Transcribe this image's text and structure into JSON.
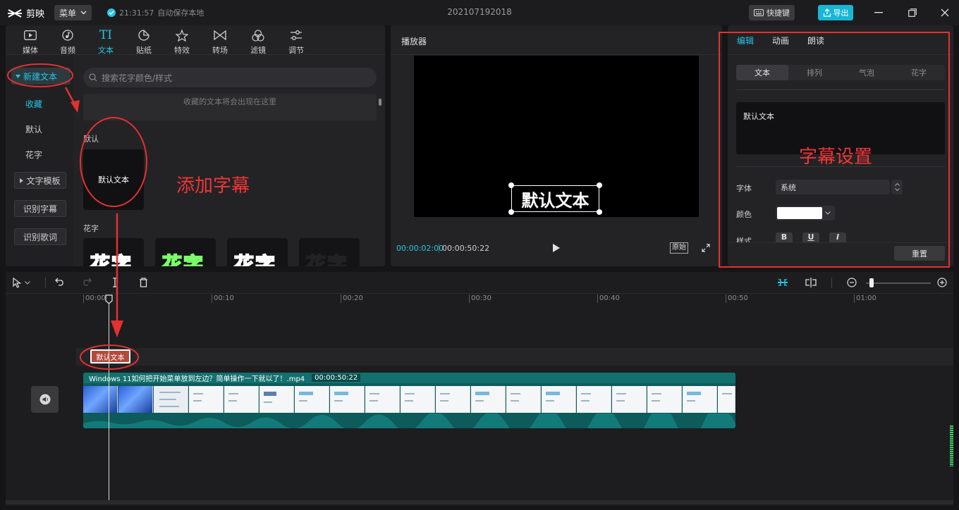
{
  "app": {
    "name": "剪映",
    "menu_label": "菜单",
    "autosave_time": "21:31:57",
    "autosave_text": "自动保存本地",
    "project_title": "202107192018",
    "shortcut_label": "快捷键",
    "export_label": "导出"
  },
  "media_tabs": [
    {
      "label": "媒体",
      "icon": "media-icon"
    },
    {
      "label": "音频",
      "icon": "audio-icon"
    },
    {
      "label": "文本",
      "icon": "text-icon",
      "active": true
    },
    {
      "label": "贴纸",
      "icon": "sticker-icon"
    },
    {
      "label": "特效",
      "icon": "effects-icon"
    },
    {
      "label": "转场",
      "icon": "transition-icon"
    },
    {
      "label": "滤镜",
      "icon": "filter-icon"
    },
    {
      "label": "调节",
      "icon": "adjust-icon"
    }
  ],
  "sidebar": {
    "new_text": "新建文本",
    "favorites": "收藏",
    "default": "默认",
    "fancy": "花字",
    "templates": "文字模板",
    "recognize_subtitles": "识别字幕",
    "recognize_lyrics": "识别歌词"
  },
  "library": {
    "search_placeholder": "搜索花字颜色/样式",
    "favorites_empty": "收藏的文本将会出现在这里",
    "default_heading": "默认",
    "default_card_text": "默认文本",
    "fancy_heading": "花字",
    "fancy_samples": [
      "花字",
      "花字",
      "花字",
      "花字"
    ]
  },
  "annotations": {
    "add_subtitle": "添加字幕",
    "subtitle_settings": "字幕设置"
  },
  "player": {
    "title": "播放器",
    "overlay_text": "默认文本",
    "current_time": "00:00:02:00",
    "total_time": "00:00:50:22",
    "ratio_label": "原始"
  },
  "inspector": {
    "tabs": [
      "编辑",
      "动画",
      "朗读"
    ],
    "subtabs": [
      "文本",
      "排列",
      "气泡",
      "花字"
    ],
    "text_value": "默认文本",
    "font_label": "字体",
    "font_value": "系统",
    "color_label": "颜色",
    "color_value": "#ffffff",
    "style_label": "样式",
    "style_buttons": [
      "B",
      "U",
      "I"
    ],
    "reset_label": "重置"
  },
  "timeline": {
    "ruler": [
      "00:00",
      "00:10",
      "00:20",
      "00:30",
      "00:40",
      "00:50",
      "01:00"
    ],
    "text_clip": "默认文本",
    "video_clip_name": "Windows 11如何把开始菜单放到左边？简单操作一下就以了！.mp4",
    "video_clip_duration": "00:00:50:22"
  },
  "colors": {
    "accent": "#27c6e3",
    "annotation": "#f03535",
    "export": "#17b7d6"
  }
}
